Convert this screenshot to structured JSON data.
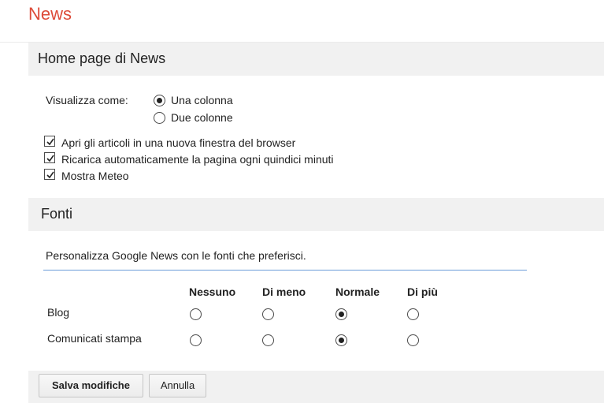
{
  "app_title": "News",
  "homepage_section": {
    "title": "Home page di News",
    "view_label": "Visualizza come:",
    "view_options": [
      {
        "label": "Una colonna",
        "selected": true
      },
      {
        "label": "Due colonne",
        "selected": false
      }
    ],
    "checkboxes": [
      {
        "label": "Apri gli articoli in una nuova finestra del browser",
        "checked": true
      },
      {
        "label": "Ricarica automaticamente la pagina ogni quindici minuti",
        "checked": true
      },
      {
        "label": "Mostra Meteo",
        "checked": true
      }
    ]
  },
  "sources_section": {
    "title": "Fonti",
    "description": "Personalizza Google News con le fonti che preferisci.",
    "columns": [
      "Nessuno",
      "Di meno",
      "Normale",
      "Di più"
    ],
    "rows": [
      {
        "label": "Blog",
        "selected": "Normale"
      },
      {
        "label": "Comunicati stampa",
        "selected": "Normale"
      }
    ]
  },
  "actions": {
    "save_label": "Salva modifiche",
    "cancel_label": "Annulla"
  },
  "colors": {
    "title_red": "#dd4b39",
    "section_bg": "#f1f1f1",
    "rule_blue": "#6b9bd8"
  }
}
